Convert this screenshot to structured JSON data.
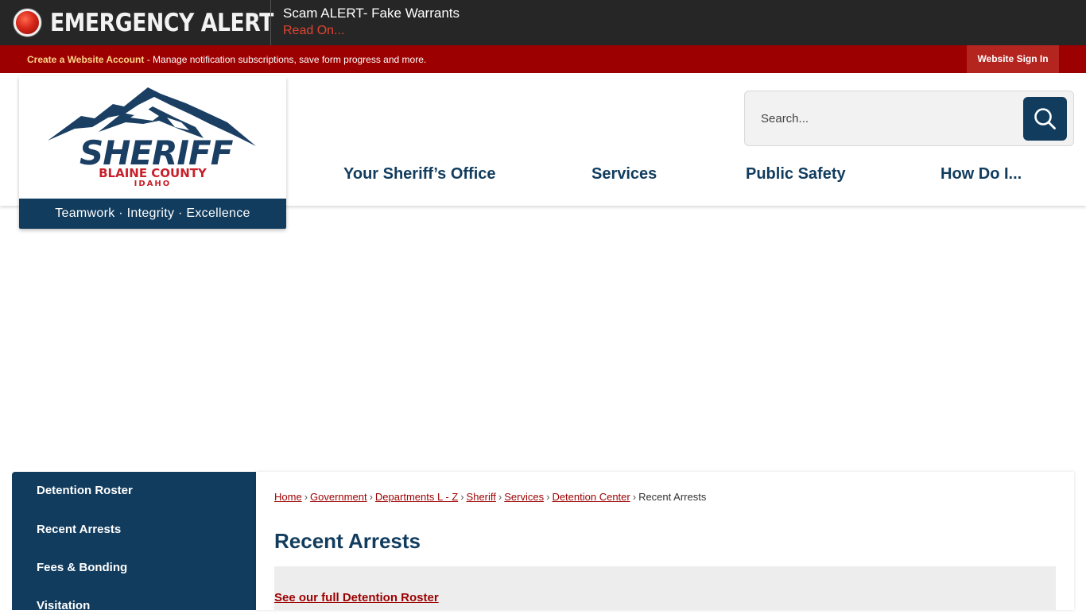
{
  "alert": {
    "title": "EMERGENCY ALERT",
    "message": "Scam ALERT- Fake Warrants",
    "link": "Read On..."
  },
  "account_bar": {
    "create_link": "Create a Website Account",
    "description": " - Manage notification subscriptions, save form progress and more.",
    "sign_in": "Website Sign In"
  },
  "logo": {
    "name": "SHERIFF",
    "county": "BLAINE COUNTY",
    "state": "IDAHO",
    "tagline": "Teamwork · Integrity · Excellence"
  },
  "search": {
    "placeholder": "Search..."
  },
  "nav": {
    "items": [
      "Your Sheriff’s Office",
      "Services",
      "Public Safety",
      "How Do I..."
    ]
  },
  "sidebar": {
    "items": [
      "Detention Roster",
      "Recent Arrests",
      "Fees & Bonding",
      "Visitation"
    ]
  },
  "breadcrumb": {
    "items": [
      "Home",
      "Government",
      "Departments L - Z",
      "Sheriff",
      "Services",
      "Detention Center"
    ],
    "current": "Recent Arrests"
  },
  "page": {
    "title": "Recent Arrests",
    "roster_link": "See our full Detention Roster"
  },
  "colors": {
    "navy": "#113c5e",
    "red": "#9d0000",
    "alert_bg": "#262626"
  }
}
